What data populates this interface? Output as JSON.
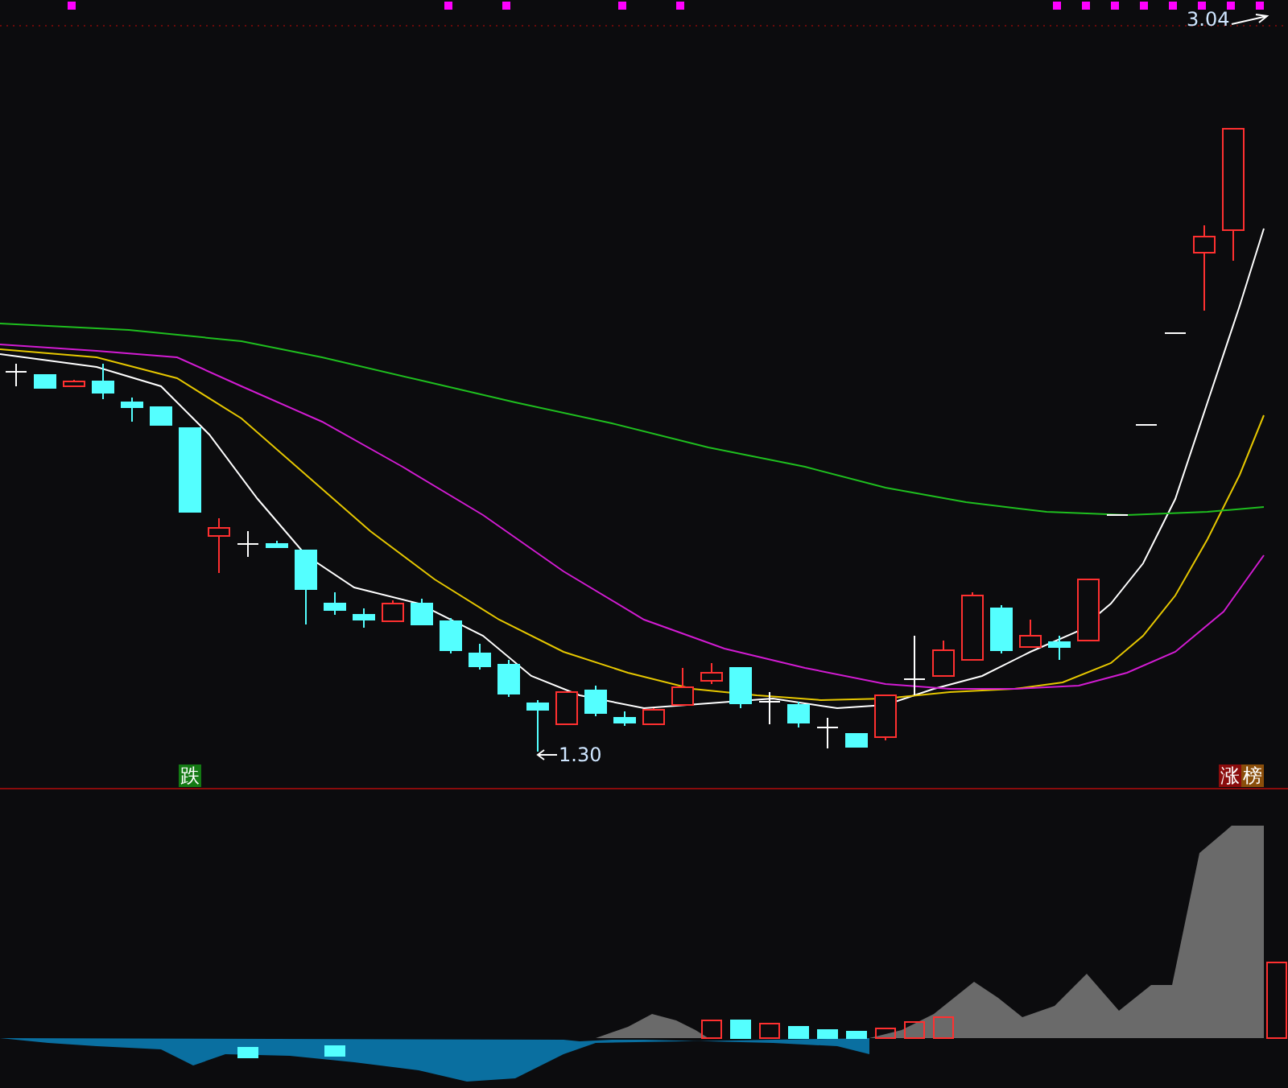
{
  "high_label": {
    "text": "3.04"
  },
  "low_label": {
    "text": "1.30"
  },
  "tags": [
    {
      "text": "跌",
      "color": "#137a13"
    },
    {
      "text": "涨",
      "color": "#8a0c0c"
    },
    {
      "text": "榜",
      "color": "#8a4e0a"
    }
  ]
}
